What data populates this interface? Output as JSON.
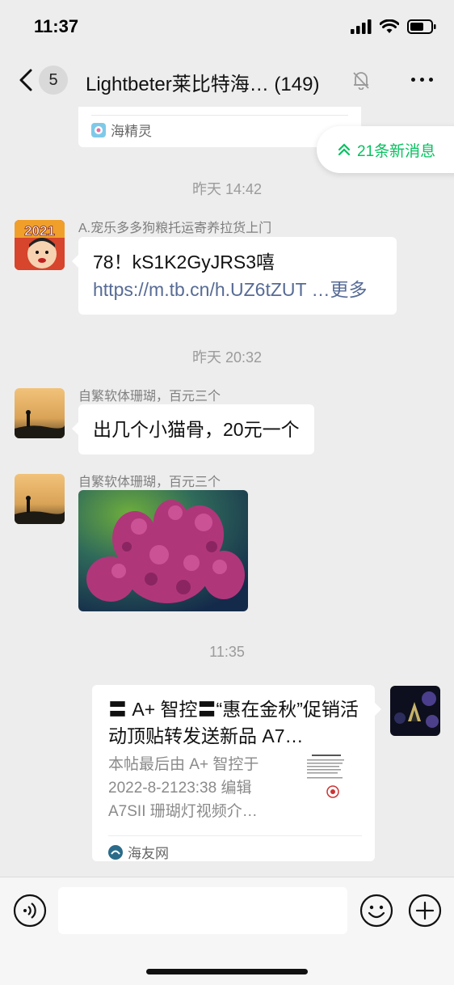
{
  "status_bar": {
    "time": "11:37"
  },
  "nav": {
    "back_icon": "chevron-left-icon",
    "unread_count": "5",
    "title": "Lightbeter莱比特海…",
    "member_count": "(149)",
    "mute_icon": "bell-off-icon",
    "more_icon": "ellipsis-icon"
  },
  "partial_card": {
    "source": "海精灵"
  },
  "new_messages": {
    "label": "21条新消息",
    "icon": "double-chevron-up-icon"
  },
  "timestamps": [
    "昨天 14:42",
    "昨天 20:32",
    "11:35"
  ],
  "messages": [
    {
      "sender": "A.宠乐多多狗粮托运寄养拉货上门",
      "avatar_text": "2021",
      "text": "78！kS1K2GyJRS3嘻 ",
      "link": "https://m.tb.cn/h.UZ6tZUT",
      "more": "…更多"
    },
    {
      "sender": "自繁软体珊瑚，百元三个",
      "text": "出几个小猫骨，20元一个"
    },
    {
      "sender": "自繁软体珊瑚，百元三个",
      "image": "coral-photo"
    }
  ],
  "share_card": {
    "title": "〓 A+ 智控〓“惠在金秋”促销活动顶贴转发送新品 A7…",
    "desc": "本帖最后由 A+ 智控于 2022-8-2123:38 编辑 A7SII 珊瑚灯视频介…",
    "source": "海友网"
  },
  "input_bar": {
    "voice_icon": "voice-icon",
    "emoji_icon": "emoji-icon",
    "plus_icon": "plus-icon",
    "placeholder": ""
  },
  "colors": {
    "background": "#ededed",
    "accent_green": "#07c160",
    "link_blue": "#576b95"
  }
}
